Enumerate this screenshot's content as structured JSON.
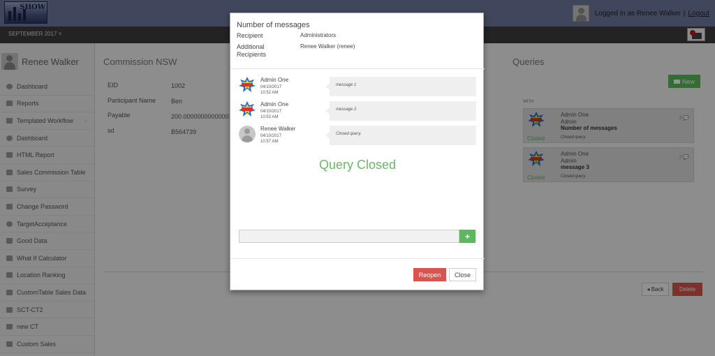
{
  "header": {
    "logo_text": "SHOW",
    "logged_in_text": "Logged in as Renee Walker",
    "separator": "|",
    "logout_label": "Logout",
    "period_label": "SEPTEMBER 2017 ˅"
  },
  "sidebar": {
    "user_name": "Renee Walker",
    "items": [
      {
        "label": "Dashboard",
        "icon": "dashboard-icon"
      },
      {
        "label": "Reports",
        "icon": "bar-chart-icon"
      },
      {
        "label": "Templated Workflow",
        "icon": "document-icon",
        "chevron": "›"
      },
      {
        "label": "Dashboard",
        "icon": "dashboard-icon"
      },
      {
        "label": "HTML Report",
        "icon": "table-icon"
      },
      {
        "label": "Sales Commission Table",
        "icon": "table-icon"
      },
      {
        "label": "Survey",
        "icon": "table-icon"
      },
      {
        "label": "Change Password",
        "icon": "lock-icon"
      },
      {
        "label": "TargetAcceptance",
        "icon": "target-icon"
      },
      {
        "label": "Good Data",
        "icon": "bar-chart-icon"
      },
      {
        "label": "What If Calculator",
        "icon": "table-icon"
      },
      {
        "label": "Location Ranking",
        "icon": "table-icon"
      },
      {
        "label": "CustomTable Sales Data",
        "icon": "table-icon"
      },
      {
        "label": "SCT-CT2",
        "icon": "table-icon"
      },
      {
        "label": "new CT",
        "icon": "table-icon"
      },
      {
        "label": "Custom Sales",
        "icon": "table-icon"
      }
    ]
  },
  "main": {
    "title": "Commission NSW",
    "fields": [
      {
        "label": "EID",
        "value": "1002"
      },
      {
        "label": "Participant Name",
        "value": "Ben"
      },
      {
        "label": "Payable",
        "value": "200.0000000000000"
      },
      {
        "label": "sd",
        "value": "B564739"
      }
    ],
    "back_label": "◂ Back",
    "delete_label": "Delete"
  },
  "queries": {
    "title": "Queries",
    "new_label": "New",
    "with_label": "WITH",
    "cards": [
      {
        "name": "Admin One",
        "role": "Admin",
        "subject": "Number of messages",
        "preview": "Closed query.",
        "status": "Closed",
        "count": "3"
      },
      {
        "name": "Admin One",
        "role": "Admin",
        "subject": "message 3",
        "preview": "Closed query.",
        "status": "Closed",
        "count": "2"
      }
    ]
  },
  "modal": {
    "title": "Number of messages",
    "recipient_label": "Recipient",
    "recipient_value": "Administrators",
    "additional_label_line1": "Additional",
    "additional_label_line2": "Recipients",
    "additional_value": "Renee Walker (renee)",
    "messages": [
      {
        "author": "Admin One",
        "date": "04/10/2017",
        "time": "10:52 AM",
        "text": "message 1",
        "avatar": "wow-icon"
      },
      {
        "author": "Admin One",
        "date": "04/10/2017",
        "time": "10:53 AM",
        "text": "message 2",
        "avatar": "wow-icon"
      },
      {
        "author": "Renee Walker",
        "date": "04/10/2017",
        "time": "10:57 AM",
        "text": "Closed query.",
        "avatar": "user-avatar-icon"
      }
    ],
    "status_text": "Query Closed",
    "reply_placeholder": "",
    "add_label": "+",
    "reopen_label": "Reopen",
    "close_label": "Close"
  },
  "colors": {
    "accent_green": "#5cb85c",
    "danger_red": "#d9534f",
    "topbar": "#6f7aa0"
  }
}
